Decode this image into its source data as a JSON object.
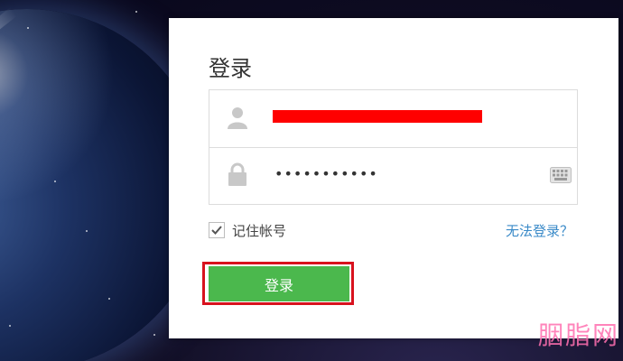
{
  "login": {
    "title": "登录",
    "password_mask": "•••••••••••",
    "remember_label": "记住帐号",
    "remember_checked": true,
    "trouble_link": "无法登录？",
    "submit_label": "登录"
  },
  "icons": {
    "user": "user-icon",
    "lock": "lock-icon",
    "keyboard": "keyboard-icon",
    "check": "checkmark-icon"
  },
  "colors": {
    "button": "#4bb84d",
    "highlight_border": "#d8121e",
    "redaction": "#ff0000",
    "link": "#3a8ac8",
    "watermark": "#ff6fb0"
  },
  "watermark": "胭脂网"
}
